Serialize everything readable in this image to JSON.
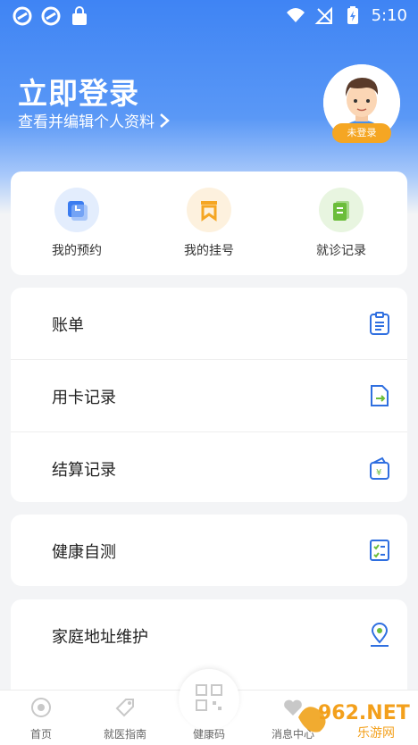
{
  "status_bar": {
    "time": "5:10"
  },
  "profile": {
    "title": "立即登录",
    "subtitle": "查看并编辑个人资料",
    "badge": "未登录"
  },
  "quick_actions": [
    {
      "label": "我的预约",
      "icon": "clock-icon",
      "color": "#3b7cf0"
    },
    {
      "label": "我的挂号",
      "icon": "bookmark-icon",
      "color": "#f5a623"
    },
    {
      "label": "就诊记录",
      "icon": "notebook-icon",
      "color": "#6bbd3a"
    }
  ],
  "list_group_1": [
    {
      "label": "账单",
      "icon": "clipboard-icon"
    },
    {
      "label": "用卡记录",
      "icon": "card-record-icon"
    },
    {
      "label": "结算记录",
      "icon": "wallet-icon"
    }
  ],
  "list_group_2": [
    {
      "label": "健康自测",
      "icon": "checklist-icon"
    }
  ],
  "list_group_3": [
    {
      "label": "家庭地址维护",
      "icon": "location-pin-icon"
    }
  ],
  "bottom_nav": {
    "home": "首页",
    "guide": "就医指南",
    "health_code": "健康码",
    "messages": "消息中心"
  },
  "watermark": {
    "text": "962.NET",
    "sub": "乐游网"
  },
  "colors": {
    "primary": "#3f84f4",
    "icon_blue": "#2f6fe0",
    "accent_orange": "#f5a623"
  }
}
